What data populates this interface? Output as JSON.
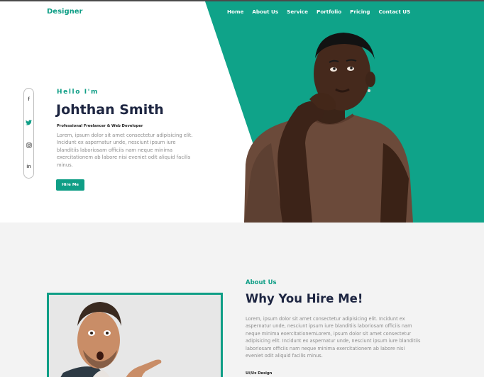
{
  "colors": {
    "accent": "#0f9e86",
    "heading": "#1d2541",
    "body_text": "#8a8a8a",
    "section_bg": "#f3f3f3"
  },
  "header": {
    "logo": "Designer",
    "nav": [
      "Home",
      "About Us",
      "Service",
      "Portfolio",
      "Pricing",
      "Contact US"
    ]
  },
  "social": {
    "icons": [
      {
        "name": "facebook-icon",
        "glyph": "f"
      },
      {
        "name": "twitter-icon",
        "glyph": ""
      },
      {
        "name": "instagram-icon",
        "glyph": ""
      },
      {
        "name": "linkedin-icon",
        "glyph": "in"
      }
    ]
  },
  "hero": {
    "greeting": "Hello I'm",
    "name": "Johthan Smith",
    "role": "Professional Freelancer & Web Developer",
    "bio": "Lorem, ipsum dolor sit amet consectetur adipisicing elit. Incidunt ex aspernatur unde, nesciunt ipsum iure blanditiis laboriosam officiis nam neque minima exercitationem ab labore nisi eveniet odit aliquid facilis minus.",
    "cta": "Hire Me"
  },
  "about": {
    "label": "About Us",
    "title": "Why You Hire Me!",
    "text": "Lorem, ipsum dolor sit amet consectetur adipisicing elit. Incidunt ex aspernatur unde, nesciunt ipsum iure blanditiis laboriosam officiis nam neque minima exercitationemLorem, ipsum dolor sit amet consectetur adipisicing elit. Incidunt ex aspernatur unde, nesciunt ipsum iure blanditiis laboriosam officiis nam neque minima exercitationem ab labore nisi eveniet odit aliquid facilis minus.",
    "skill_label": "Ui/Ux Design"
  }
}
